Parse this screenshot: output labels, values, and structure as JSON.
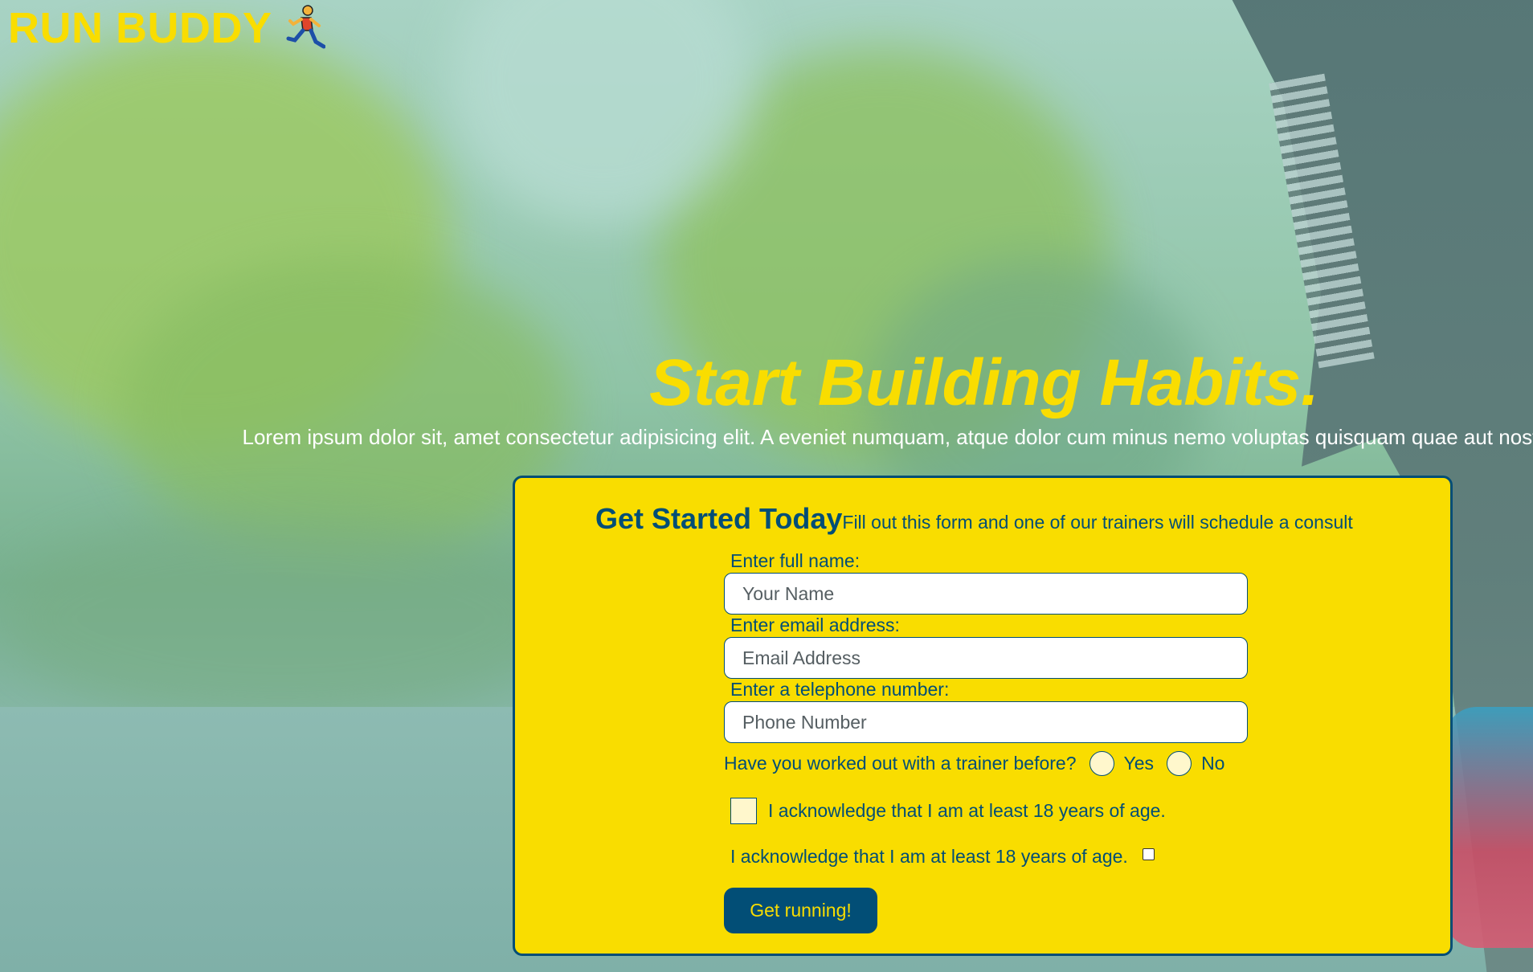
{
  "brand": {
    "name": "RUN BUDDY",
    "icon": "running-person-icon"
  },
  "hero": {
    "title": "Start Building Habits.",
    "text": "Lorem ipsum dolor sit, amet consectetur adipisicing elit. A eveniet numquam, atque dolor cum minus nemo voluptas quisquam quae aut nostrum, possimus nam!"
  },
  "form": {
    "heading": "Get Started Today",
    "subheading": "Fill out this form and one of our trainers will schedule a consult",
    "name_label": "Enter full name:",
    "name_placeholder": "Your Name",
    "email_label": "Enter email address:",
    "email_placeholder": "Email Address",
    "phone_label": "Enter a telephone number:",
    "phone_placeholder": "Phone Number",
    "trainer_question": "Have you worked out with a trainer before?",
    "yes_label": "Yes",
    "no_label": "No",
    "ack_label_1": "I acknowledge that I am at least 18 years of age.",
    "ack_label_2": "I acknowledge that I am at least 18 years of age.",
    "submit_label": "Get running!"
  },
  "colors": {
    "accent_yellow": "#f9dd00",
    "primary_blue": "#024e76",
    "hero_text": "#ffffff"
  }
}
